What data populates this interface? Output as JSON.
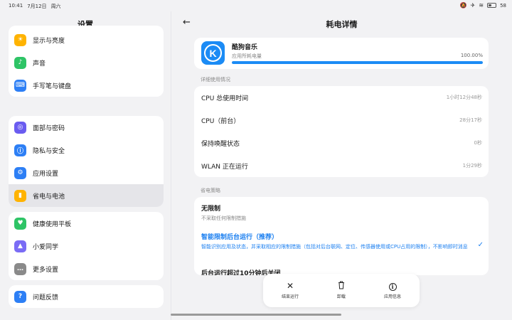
{
  "status_bar": {
    "time": "10:41",
    "date": "7月12日",
    "weekday": "周六",
    "battery": "58",
    "battery_level": 0.58
  },
  "left": {
    "title": "设置",
    "groups": [
      {
        "items": [
          {
            "label": "显示与亮度",
            "icon": "sun-icon",
            "color": "#ffb300",
            "glyph": "☀"
          },
          {
            "label": "声音",
            "icon": "sound-icon",
            "color": "#2ec466",
            "glyph": "♪"
          },
          {
            "label": "手写笔与键盘",
            "icon": "keyboard-icon",
            "color": "#2d7ff5",
            "glyph": "⌨"
          }
        ]
      },
      {
        "items": [
          {
            "label": "面部与密码",
            "icon": "face-icon",
            "color": "#6a5cf0",
            "glyph": "◎"
          },
          {
            "label": "隐私与安全",
            "icon": "privacy-icon",
            "color": "#2d7ff5",
            "glyph": "ⓘ"
          },
          {
            "label": "应用设置",
            "icon": "app-settings-icon",
            "color": "#2d7ff5",
            "glyph": "⚙"
          },
          {
            "label": "省电与电池",
            "icon": "battery-icon",
            "color": "#ffb300",
            "glyph": "▮",
            "active": true
          }
        ]
      },
      {
        "items": [
          {
            "label": "健康使用平板",
            "icon": "health-icon",
            "color": "#2ec466",
            "glyph": "♥"
          },
          {
            "label": "小爱同学",
            "icon": "assistant-icon",
            "color": "#7a6cf5",
            "glyph": "▲"
          },
          {
            "label": "更多设置",
            "icon": "more-icon",
            "color": "#8a8a8a",
            "glyph": "…"
          }
        ]
      },
      {
        "items": [
          {
            "label": "问题反馈",
            "icon": "feedback-icon",
            "color": "#2d7ff5",
            "glyph": "?"
          }
        ]
      }
    ]
  },
  "right": {
    "title": "耗电详情",
    "app": {
      "name": "酷狗音乐",
      "subtitle": "应用所耗电量",
      "percent": "100.00%",
      "usage_fraction": 1.0,
      "icon_letter": "K"
    },
    "detail_label": "详细使用情况",
    "details": [
      {
        "key": "CPU 总使用时间",
        "value": "1小时12分48秒"
      },
      {
        "key": "CPU（前台）",
        "value": "28分17秒"
      },
      {
        "key": "保持唤醒状态",
        "value": "0秒"
      },
      {
        "key": "WLAN 正在运行",
        "value": "1分29秒"
      }
    ],
    "policy_label": "省电策略",
    "policies": [
      {
        "title": "无限制",
        "desc": "不采取任何限制措施",
        "selected": false
      },
      {
        "title": "智能限制后台运行（推荐）",
        "desc": "智能识别应用及状态，并采取相应的限制措施（包括对后台联网、定位、传感器使用或CPU占用的限制），不影响即时消息",
        "selected": true
      },
      {
        "title": "后台运行超过10分钟后关闭",
        "desc": "",
        "selected": false
      }
    ],
    "actions": [
      {
        "label": "结束运行",
        "icon": "close-icon",
        "glyph": "✕"
      },
      {
        "label": "卸载",
        "icon": "trash-icon",
        "glyph": "🗑"
      },
      {
        "label": "应用信息",
        "icon": "info-icon",
        "glyph": "i"
      }
    ]
  },
  "colors": {
    "accent": "#1b7ff0",
    "progress": "#1b8bf5"
  }
}
